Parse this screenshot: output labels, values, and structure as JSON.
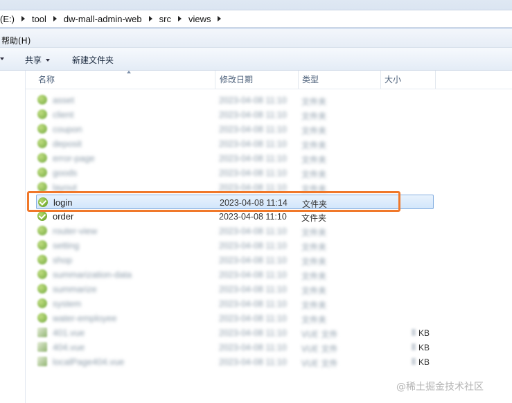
{
  "address": {
    "crumbs": [
      "(E:)",
      "tool",
      "dw-mall-admin-web",
      "src",
      "views"
    ]
  },
  "menu": {
    "help": "帮助(H)"
  },
  "toolbar": {
    "share_label": "共享",
    "new_folder_label": "新建文件夹"
  },
  "columns": {
    "name": "名称",
    "date": "修改日期",
    "type": "类型",
    "size": "大小"
  },
  "rows": [
    {
      "name": "asset",
      "date": "2023-04-08 11:10",
      "type": "文件夹",
      "size": "",
      "kind": "folder",
      "blurred": true
    },
    {
      "name": "client",
      "date": "2023-04-08 11:10",
      "type": "文件夹",
      "size": "",
      "kind": "folder",
      "blurred": true
    },
    {
      "name": "coupon",
      "date": "2023-04-08 11:10",
      "type": "文件夹",
      "size": "",
      "kind": "folder",
      "blurred": true
    },
    {
      "name": "deposit",
      "date": "2023-04-08 11:10",
      "type": "文件夹",
      "size": "",
      "kind": "folder",
      "blurred": true
    },
    {
      "name": "error-page",
      "date": "2023-04-08 11:10",
      "type": "文件夹",
      "size": "",
      "kind": "folder",
      "blurred": true
    },
    {
      "name": "goods",
      "date": "2023-04-08 11:10",
      "type": "文件夹",
      "size": "",
      "kind": "folder",
      "blurred": true
    },
    {
      "name": "layout",
      "date": "2023-04-08 11:10",
      "type": "文件夹",
      "size": "",
      "kind": "folder",
      "blurred": true
    },
    {
      "name": "login",
      "date": "2023-04-08 11:14",
      "type": "文件夹",
      "size": "",
      "kind": "folder",
      "blurred": false,
      "selected": true
    },
    {
      "name": "order",
      "date": "2023-04-08 11:10",
      "type": "文件夹",
      "size": "",
      "kind": "folder",
      "blurred": false
    },
    {
      "name": "router-view",
      "date": "2023-04-08 11:10",
      "type": "文件夹",
      "size": "",
      "kind": "folder",
      "blurred": true
    },
    {
      "name": "setting",
      "date": "2023-04-08 11:10",
      "type": "文件夹",
      "size": "",
      "kind": "folder",
      "blurred": true
    },
    {
      "name": "shop",
      "date": "2023-04-08 11:10",
      "type": "文件夹",
      "size": "",
      "kind": "folder",
      "blurred": true
    },
    {
      "name": "summarization-data",
      "date": "2023-04-08 11:10",
      "type": "文件夹",
      "size": "",
      "kind": "folder",
      "blurred": true
    },
    {
      "name": "summarize",
      "date": "2023-04-08 11:10",
      "type": "文件夹",
      "size": "",
      "kind": "folder",
      "blurred": true
    },
    {
      "name": "system",
      "date": "2023-04-08 11:10",
      "type": "文件夹",
      "size": "",
      "kind": "folder",
      "blurred": true
    },
    {
      "name": "water-employee",
      "date": "2023-04-08 11:10",
      "type": "文件夹",
      "size": "",
      "kind": "folder",
      "blurred": true
    },
    {
      "name": "401.vue",
      "date": "2023-04-08 11:10",
      "type": "VUE 文件",
      "size": "KB",
      "kind": "file",
      "blurred": true
    },
    {
      "name": "404.vue",
      "date": "2023-04-08 11:10",
      "type": "VUE 文件",
      "size": "KB",
      "kind": "file",
      "blurred": true
    },
    {
      "name": "localPage404.vue",
      "date": "2023-04-08 11:10",
      "type": "VUE 文件",
      "size": "KB",
      "kind": "file",
      "blurred": true
    }
  ],
  "watermark": "@稀土掘金技术社区"
}
